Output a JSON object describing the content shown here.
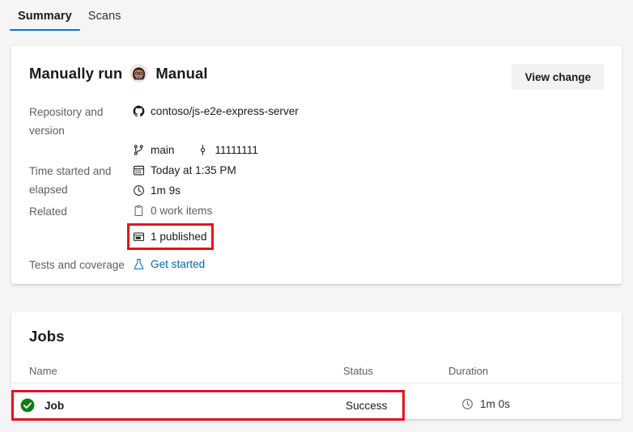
{
  "tabs": [
    {
      "label": "Summary",
      "active": true
    },
    {
      "label": "Scans",
      "active": false
    }
  ],
  "summary": {
    "run_title": "Manually run",
    "trigger": "Manual",
    "avatar_icon": "user-avatar",
    "view_change_button": "View change",
    "rows": [
      {
        "label": "Repository and version",
        "lines": [
          {
            "icon": "github-icon",
            "text": "contoso/js-e2e-express-server"
          }
        ]
      },
      {
        "label": "",
        "lines": [
          {
            "icon": "branch-icon",
            "text": "main"
          },
          {
            "icon": "commit-icon",
            "text": "11111111"
          }
        ]
      },
      {
        "label": "Time started and elapsed",
        "lines": [
          {
            "icon": "calendar-icon",
            "text": "Today at 1:35 PM"
          },
          {
            "icon": "clock-icon",
            "text": "1m 9s"
          }
        ]
      },
      {
        "label": "Related",
        "lines": [
          {
            "icon": "work-items-icon",
            "text": "0 work items"
          },
          {
            "icon": "artifact-icon",
            "text": "1 published"
          }
        ]
      },
      {
        "label": "Tests and coverage",
        "lines": [
          {
            "icon": "beaker-icon",
            "text": "Get started"
          }
        ]
      }
    ],
    "labels": {
      "repository_and_version": "Repository and version",
      "time_started_and_elapsed": "Time started and elapsed",
      "related": "Related",
      "tests_and_coverage": "Tests and coverage"
    },
    "values": {
      "repository": "contoso/js-e2e-express-server",
      "branch": "main",
      "commit": "11111111",
      "time_started": "Today at 1:35 PM",
      "elapsed": "1m 9s",
      "work_items": "0 work items",
      "published": "1 published",
      "tests_link": "Get started"
    }
  },
  "jobs": {
    "title": "Jobs",
    "columns": {
      "name": "Name",
      "status": "Status",
      "duration": "Duration"
    },
    "rows": [
      {
        "name": "Job",
        "status": "Success",
        "status_icon": "success-check-icon",
        "duration": "1m 0s",
        "duration_icon": "clock-icon",
        "highlighted": true
      }
    ]
  },
  "colors": {
    "accent": "#0078d4",
    "link": "#0067b8",
    "highlight": "#e81123",
    "success": "#107c10",
    "page_background": "#f5f5f5",
    "card_background": "#ffffff",
    "muted_text": "#605e5c"
  }
}
